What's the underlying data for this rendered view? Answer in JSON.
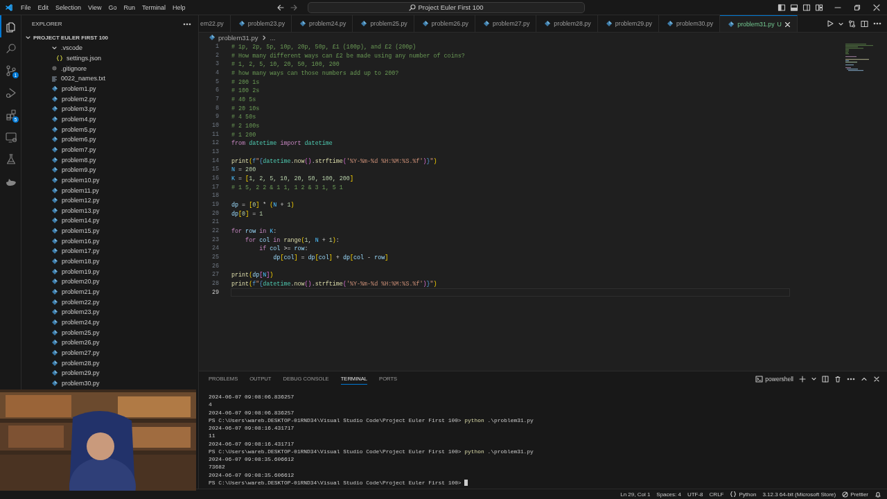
{
  "title_bar": {
    "menu": [
      "File",
      "Edit",
      "Selection",
      "View",
      "Go",
      "Run",
      "Terminal",
      "Help"
    ],
    "search": "Project Euler First 100"
  },
  "activity_bar": [
    {
      "kind": "files",
      "selected": true
    },
    {
      "kind": "search",
      "selected": false
    },
    {
      "kind": "source-control",
      "selected": false,
      "badge": "1"
    },
    {
      "kind": "debug",
      "selected": false
    },
    {
      "kind": "extensions",
      "selected": false,
      "badge": "5"
    },
    {
      "kind": "remote",
      "selected": false
    },
    {
      "kind": "testing",
      "selected": false
    },
    {
      "kind": "docker",
      "selected": false
    }
  ],
  "sidebar": {
    "title": "EXPLORER",
    "folder": {
      "name": "PROJECT EULER FIRST 100",
      "expanded": true
    },
    "items": [
      {
        "name": ".vscode",
        "kind": "folder",
        "expanded": true,
        "children": [
          {
            "name": "settings.json",
            "kind": "json"
          }
        ]
      },
      {
        "name": ".gitignore",
        "kind": "gitignore"
      },
      {
        "name": "0022_names.txt",
        "kind": "text"
      },
      {
        "name": "problem1.py",
        "kind": "python"
      },
      {
        "name": "problem2.py",
        "kind": "python"
      },
      {
        "name": "problem3.py",
        "kind": "python"
      },
      {
        "name": "problem4.py",
        "kind": "python"
      },
      {
        "name": "problem5.py",
        "kind": "python"
      },
      {
        "name": "problem6.py",
        "kind": "python"
      },
      {
        "name": "problem7.py",
        "kind": "python"
      },
      {
        "name": "problem8.py",
        "kind": "python"
      },
      {
        "name": "problem9.py",
        "kind": "python"
      },
      {
        "name": "problem10.py",
        "kind": "python"
      },
      {
        "name": "problem11.py",
        "kind": "python"
      },
      {
        "name": "problem12.py",
        "kind": "python"
      },
      {
        "name": "problem13.py",
        "kind": "python"
      },
      {
        "name": "problem14.py",
        "kind": "python"
      },
      {
        "name": "problem15.py",
        "kind": "python"
      },
      {
        "name": "problem16.py",
        "kind": "python"
      },
      {
        "name": "problem17.py",
        "kind": "python"
      },
      {
        "name": "problem18.py",
        "kind": "python"
      },
      {
        "name": "problem19.py",
        "kind": "python"
      },
      {
        "name": "problem20.py",
        "kind": "python"
      },
      {
        "name": "problem21.py",
        "kind": "python"
      },
      {
        "name": "problem22.py",
        "kind": "python"
      },
      {
        "name": "problem23.py",
        "kind": "python"
      },
      {
        "name": "problem24.py",
        "kind": "python"
      },
      {
        "name": "problem25.py",
        "kind": "python"
      },
      {
        "name": "problem26.py",
        "kind": "python"
      },
      {
        "name": "problem27.py",
        "kind": "python"
      },
      {
        "name": "problem28.py",
        "kind": "python"
      },
      {
        "name": "problem29.py",
        "kind": "python"
      },
      {
        "name": "problem30.py",
        "kind": "python"
      }
    ]
  },
  "tabs": [
    {
      "label": "em22.py",
      "selected": false,
      "clipped": true
    },
    {
      "label": "problem23.py",
      "selected": false,
      "clipped": false
    },
    {
      "label": "problem24.py",
      "selected": false,
      "clipped": false
    },
    {
      "label": "problem25.py",
      "selected": false,
      "clipped": false
    },
    {
      "label": "problem26.py",
      "selected": false,
      "clipped": false
    },
    {
      "label": "problem27.py",
      "selected": false,
      "clipped": false
    },
    {
      "label": "problem28.py",
      "selected": false,
      "clipped": false
    },
    {
      "label": "problem29.py",
      "selected": false,
      "clipped": false
    },
    {
      "label": "problem30.py",
      "selected": false,
      "clipped": false
    },
    {
      "label": "problem31.py",
      "selected": true,
      "clipped": false,
      "status": "U"
    }
  ],
  "breadcrumb": [
    "problem31.py",
    "..."
  ],
  "editor": {
    "lines": [
      {
        "number": "1",
        "current": false,
        "tokens": [
          {
            "t": "# 1p, 2p, 5p, 10p, 20p, 50p, £1 (100p), and £2 (200p)",
            "kind": "cm"
          }
        ]
      },
      {
        "number": "2",
        "current": false,
        "tokens": [
          {
            "t": "# How many different ways can £2 be made using any number of coins?",
            "kind": "cm"
          }
        ]
      },
      {
        "number": "3",
        "current": false,
        "tokens": [
          {
            "t": "# 1, 2, 5, 10, 20, 50, 100, 200",
            "kind": "cm"
          }
        ]
      },
      {
        "number": "4",
        "current": false,
        "tokens": [
          {
            "t": "# how many ways can those numbers add up to 200?",
            "kind": "cm"
          }
        ]
      },
      {
        "number": "5",
        "current": false,
        "tokens": [
          {
            "t": "# 200 1s",
            "kind": "cm"
          }
        ]
      },
      {
        "number": "6",
        "current": false,
        "tokens": [
          {
            "t": "# 100 2s",
            "kind": "cm"
          }
        ]
      },
      {
        "number": "7",
        "current": false,
        "tokens": [
          {
            "t": "# 40 5s",
            "kind": "cm"
          }
        ]
      },
      {
        "number": "8",
        "current": false,
        "tokens": [
          {
            "t": "# 20 10s",
            "kind": "cm"
          }
        ]
      },
      {
        "number": "9",
        "current": false,
        "tokens": [
          {
            "t": "# 4 50s",
            "kind": "cm"
          }
        ]
      },
      {
        "number": "10",
        "current": false,
        "tokens": [
          {
            "t": "# 2 100s",
            "kind": "cm"
          }
        ]
      },
      {
        "number": "11",
        "current": false,
        "tokens": [
          {
            "t": "# 1 200",
            "kind": "cm"
          }
        ]
      },
      {
        "number": "12",
        "current": false,
        "tokens": [
          {
            "t": "from ",
            "kind": "kw"
          },
          {
            "t": "datetime ",
            "kind": "mod"
          },
          {
            "t": "import ",
            "kind": "kw"
          },
          {
            "t": "datetime",
            "kind": "mod"
          }
        ]
      },
      {
        "number": "13",
        "current": false
      },
      {
        "number": "14",
        "current": false,
        "tokens": [
          {
            "t": "print",
            "kind": "fn"
          },
          {
            "t": "(",
            "kind": "br"
          },
          {
            "t": "f",
            "kind": "kwb"
          },
          {
            "t": "\"",
            "kind": "str"
          },
          {
            "t": "{",
            "kind": "kwb"
          },
          {
            "t": "datetime",
            "kind": "mod"
          },
          {
            "t": ".",
            "kind": "op"
          },
          {
            "t": "now",
            "kind": "fn"
          },
          {
            "t": "()",
            "kind": "br2"
          },
          {
            "t": ".",
            "kind": "op"
          },
          {
            "t": "strftime",
            "kind": "fn"
          },
          {
            "t": "(",
            "kind": "br2"
          },
          {
            "t": "'%Y-%m-%d %H:%M:%S.%f'",
            "kind": "str"
          },
          {
            "t": ")",
            "kind": "br2"
          },
          {
            "t": "}",
            "kind": "kwb"
          },
          {
            "t": "\"",
            "kind": "str"
          },
          {
            "t": ")",
            "kind": "br"
          }
        ]
      },
      {
        "number": "15",
        "current": false,
        "tokens": [
          {
            "t": "N",
            "kind": "const"
          },
          {
            "t": " = ",
            "kind": "op"
          },
          {
            "t": "200",
            "kind": "num"
          }
        ]
      },
      {
        "number": "16",
        "current": false,
        "tokens": [
          {
            "t": "K",
            "kind": "const"
          },
          {
            "t": " = ",
            "kind": "op"
          },
          {
            "t": "[",
            "kind": "br"
          },
          {
            "t": "1, 2, 5, 10, 20, 50, 100, 200",
            "kind": "num"
          },
          {
            "t": "]",
            "kind": "br"
          }
        ]
      },
      {
        "number": "17",
        "current": false,
        "tokens": [
          {
            "t": "# 1 5, 2 2 & 1 1, 1 2 & 3 1, 5 1",
            "kind": "cm"
          }
        ]
      },
      {
        "number": "18",
        "current": false
      },
      {
        "number": "19",
        "current": false,
        "tokens": [
          {
            "t": "dp",
            "kind": "var"
          },
          {
            "t": " = ",
            "kind": "op"
          },
          {
            "t": "[",
            "kind": "br"
          },
          {
            "t": "0",
            "kind": "num"
          },
          {
            "t": "]",
            "kind": "br"
          },
          {
            "t": " * ",
            "kind": "op"
          },
          {
            "t": "(",
            "kind": "br"
          },
          {
            "t": "N",
            "kind": "const"
          },
          {
            "t": " + ",
            "kind": "op"
          },
          {
            "t": "1",
            "kind": "num"
          },
          {
            "t": ")",
            "kind": "br"
          }
        ]
      },
      {
        "number": "20",
        "current": false,
        "tokens": [
          {
            "t": "dp",
            "kind": "var"
          },
          {
            "t": "[",
            "kind": "br"
          },
          {
            "t": "0",
            "kind": "num"
          },
          {
            "t": "]",
            "kind": "br"
          },
          {
            "t": " = ",
            "kind": "op"
          },
          {
            "t": "1",
            "kind": "num"
          }
        ]
      },
      {
        "number": "21",
        "current": false
      },
      {
        "number": "22",
        "current": false,
        "tokens": [
          {
            "t": "for ",
            "kind": "kw"
          },
          {
            "t": "row ",
            "kind": "var"
          },
          {
            "t": "in ",
            "kind": "kw"
          },
          {
            "t": "K",
            "kind": "const"
          },
          {
            "t": ":",
            "kind": "op"
          }
        ]
      },
      {
        "number": "23",
        "current": false,
        "tokens": [
          {
            "t": "    for ",
            "kind": "kw"
          },
          {
            "t": "col ",
            "kind": "var"
          },
          {
            "t": "in ",
            "kind": "kw"
          },
          {
            "t": "range",
            "kind": "fn"
          },
          {
            "t": "(",
            "kind": "br"
          },
          {
            "t": "1",
            "kind": "num"
          },
          {
            "t": ", ",
            "kind": "op"
          },
          {
            "t": "N",
            "kind": "const"
          },
          {
            "t": " + ",
            "kind": "op"
          },
          {
            "t": "1",
            "kind": "num"
          },
          {
            "t": ")",
            "kind": "br"
          },
          {
            "t": ":",
            "kind": "op"
          }
        ]
      },
      {
        "number": "24",
        "current": false,
        "tokens": [
          {
            "t": "        if ",
            "kind": "kw"
          },
          {
            "t": "col",
            "kind": "var"
          },
          {
            "t": " >= ",
            "kind": "op"
          },
          {
            "t": "row",
            "kind": "var"
          },
          {
            "t": ":",
            "kind": "op"
          }
        ]
      },
      {
        "number": "25",
        "current": false,
        "tokens": [
          {
            "t": "            dp",
            "kind": "var"
          },
          {
            "t": "[",
            "kind": "br"
          },
          {
            "t": "col",
            "kind": "var"
          },
          {
            "t": "]",
            "kind": "br"
          },
          {
            "t": " = ",
            "kind": "op"
          },
          {
            "t": "dp",
            "kind": "var"
          },
          {
            "t": "[",
            "kind": "br"
          },
          {
            "t": "col",
            "kind": "var"
          },
          {
            "t": "]",
            "kind": "br"
          },
          {
            "t": " + ",
            "kind": "op"
          },
          {
            "t": "dp",
            "kind": "var"
          },
          {
            "t": "[",
            "kind": "br"
          },
          {
            "t": "col",
            "kind": "var"
          },
          {
            "t": " - ",
            "kind": "op"
          },
          {
            "t": "row",
            "kind": "var"
          },
          {
            "t": "]",
            "kind": "br"
          }
        ]
      },
      {
        "number": "26",
        "current": false
      },
      {
        "number": "27",
        "current": false,
        "tokens": [
          {
            "t": "print",
            "kind": "fn"
          },
          {
            "t": "(",
            "kind": "br"
          },
          {
            "t": "dp",
            "kind": "var"
          },
          {
            "t": "[",
            "kind": "br2"
          },
          {
            "t": "N",
            "kind": "const"
          },
          {
            "t": "]",
            "kind": "br2"
          },
          {
            "t": ")",
            "kind": "br"
          }
        ]
      },
      {
        "number": "28",
        "current": false,
        "tokens": [
          {
            "t": "print",
            "kind": "fn"
          },
          {
            "t": "(",
            "kind": "br"
          },
          {
            "t": "f",
            "kind": "kwb"
          },
          {
            "t": "\"",
            "kind": "str"
          },
          {
            "t": "{",
            "kind": "kwb"
          },
          {
            "t": "datetime",
            "kind": "mod"
          },
          {
            "t": ".",
            "kind": "op"
          },
          {
            "t": "now",
            "kind": "fn"
          },
          {
            "t": "()",
            "kind": "br2"
          },
          {
            "t": ".",
            "kind": "op"
          },
          {
            "t": "strftime",
            "kind": "fn"
          },
          {
            "t": "(",
            "kind": "br2"
          },
          {
            "t": "'%Y-%m-%d %H:%M:%S.%f'",
            "kind": "str"
          },
          {
            "t": ")",
            "kind": "br2"
          },
          {
            "t": "}",
            "kind": "kwb"
          },
          {
            "t": "\"",
            "kind": "str"
          },
          {
            "t": ")",
            "kind": "br"
          }
        ]
      },
      {
        "number": "29",
        "current": true
      }
    ]
  },
  "panel": {
    "tabs": [
      {
        "label": "PROBLEMS",
        "selected": false
      },
      {
        "label": "OUTPUT",
        "selected": false
      },
      {
        "label": "DEBUG CONSOLE",
        "selected": false
      },
      {
        "label": "TERMINAL",
        "selected": true
      },
      {
        "label": "PORTS",
        "selected": false
      }
    ],
    "terminal_name": "powershell",
    "terminal": [
      {
        "kind": "output",
        "text": "2024-06-07 09:08:06.836257"
      },
      {
        "kind": "output",
        "text": "4"
      },
      {
        "kind": "output",
        "text": "2024-06-07 09:08:06.836257"
      },
      {
        "kind": "prompt",
        "prompt": "PS C:\\Users\\wareb.DESKTOP-01RND34\\Visual Studio Code\\Project Euler First 100>",
        "command": "python",
        "args": ".\\problem31.py"
      },
      {
        "kind": "output",
        "text": "2024-06-07 09:08:16.431717"
      },
      {
        "kind": "output",
        "text": "11"
      },
      {
        "kind": "output",
        "text": "2024-06-07 09:08:16.431717"
      },
      {
        "kind": "prompt",
        "prompt": "PS C:\\Users\\wareb.DESKTOP-01RND34\\Visual Studio Code\\Project Euler First 100>",
        "command": "python",
        "args": ".\\problem31.py"
      },
      {
        "kind": "output",
        "text": "2024-06-07 09:08:35.606612"
      },
      {
        "kind": "output",
        "text": "73682"
      },
      {
        "kind": "output",
        "text": "2024-06-07 09:08:35.606612"
      },
      {
        "kind": "prompt",
        "prompt": "PS C:\\Users\\wareb.DESKTOP-01RND34\\Visual Studio Code\\Project Euler First 100>",
        "cursor": true
      }
    ]
  },
  "status_bar": [
    {
      "kind": "text",
      "label": "Ln 29, Col 1"
    },
    {
      "kind": "text",
      "label": "Spaces: 4"
    },
    {
      "kind": "text",
      "label": "UTF-8"
    },
    {
      "kind": "text",
      "label": "CRLF"
    },
    {
      "kind": "language",
      "label": "Python"
    },
    {
      "kind": "text",
      "label": "3.12.3 64-bit (Microsoft Store)"
    },
    {
      "kind": "prettier",
      "label": "Prettier"
    },
    {
      "kind": "bell"
    }
  ],
  "webcam": {
    "kind": "picture"
  }
}
